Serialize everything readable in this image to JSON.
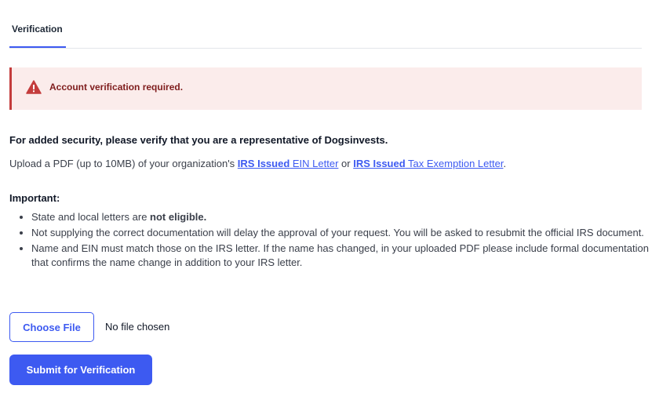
{
  "tabs": [
    {
      "label": "Verification",
      "active": true
    }
  ],
  "alert": {
    "text": "Account verification required.",
    "icon": "warning-triangle-icon",
    "color": "#c43c3c",
    "background": "#fbeceb"
  },
  "lead_text": "For added security, please verify that you are a representative of Dogsinvests.",
  "upload": {
    "prefix": "Upload a PDF (up to 10MB) of your organization's ",
    "link1_bold": "IRS Issued",
    "link1_rest": " EIN Letter",
    "between": " or ",
    "link2_bold": "IRS Issued",
    "link2_rest": " Tax Exemption Letter",
    "suffix": "."
  },
  "important": {
    "title": "Important:",
    "item1_prefix": "State and local letters are ",
    "item1_bold": "not eligible.",
    "item2": "Not supplying the correct documentation will delay the approval of your request. You will be asked to resubmit the official IRS document.",
    "item3": "Name and EIN must match those on the IRS letter. If the name has changed, in your uploaded PDF please include formal documentation that confirms the name change in addition to your IRS letter."
  },
  "file_input": {
    "button_label": "Choose File",
    "status": "No file chosen"
  },
  "submit_label": "Submit for Verification",
  "accent_color": "#3d5af1"
}
